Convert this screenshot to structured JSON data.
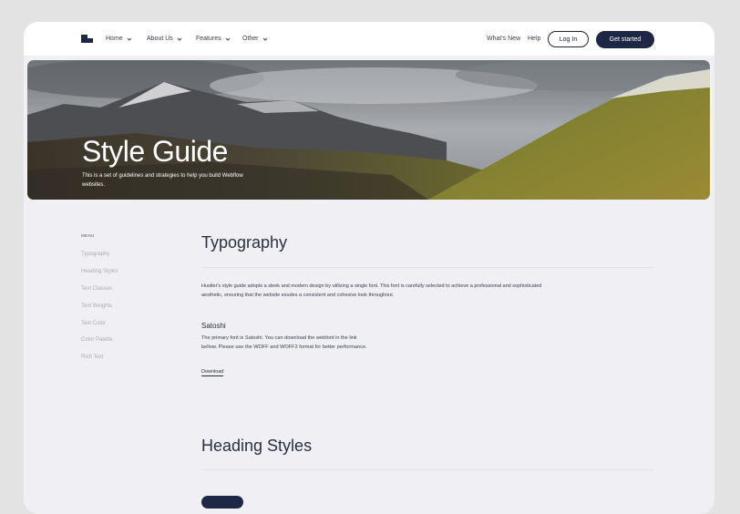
{
  "nav": {
    "items": [
      {
        "label": "Home"
      },
      {
        "label": "About Us"
      },
      {
        "label": "Features"
      },
      {
        "label": "Other"
      }
    ],
    "whats_new": "What's New",
    "help": "Help",
    "login": "Log In",
    "get_started": "Get started"
  },
  "hero": {
    "title": "Style Guide",
    "description": "This is a set of guidelines and strategies to help you build Webflow websites."
  },
  "sidebar": {
    "menu_label": "MENU",
    "items": [
      {
        "label": "Typography"
      },
      {
        "label": "Heading Styles"
      },
      {
        "label": "Text Classes"
      },
      {
        "label": "Text Weights"
      },
      {
        "label": "Text Color"
      },
      {
        "label": "Color Palette"
      },
      {
        "label": "Rich Text"
      }
    ]
  },
  "typography": {
    "title": "Typography",
    "intro": "Hustler's style guide adopts a sleek and modern design by utilizing a single font. This font is carefully selected to achieve a professional and sophisticated aesthetic, ensuring that the website exudes a consistent and cohesive look throughout.",
    "font_name": "Satoshi",
    "font_desc": "The primary font is Satoshi. You can download the webfont in the link bellow. Please use the WOFF and WOFF2 format for better performance.",
    "download": "Download"
  },
  "heading_styles": {
    "title": "Heading Styles"
  },
  "colors": {
    "primary": "#1e2846",
    "page_bg": "#f0f0f4",
    "outer_bg": "#e3e3e3"
  }
}
